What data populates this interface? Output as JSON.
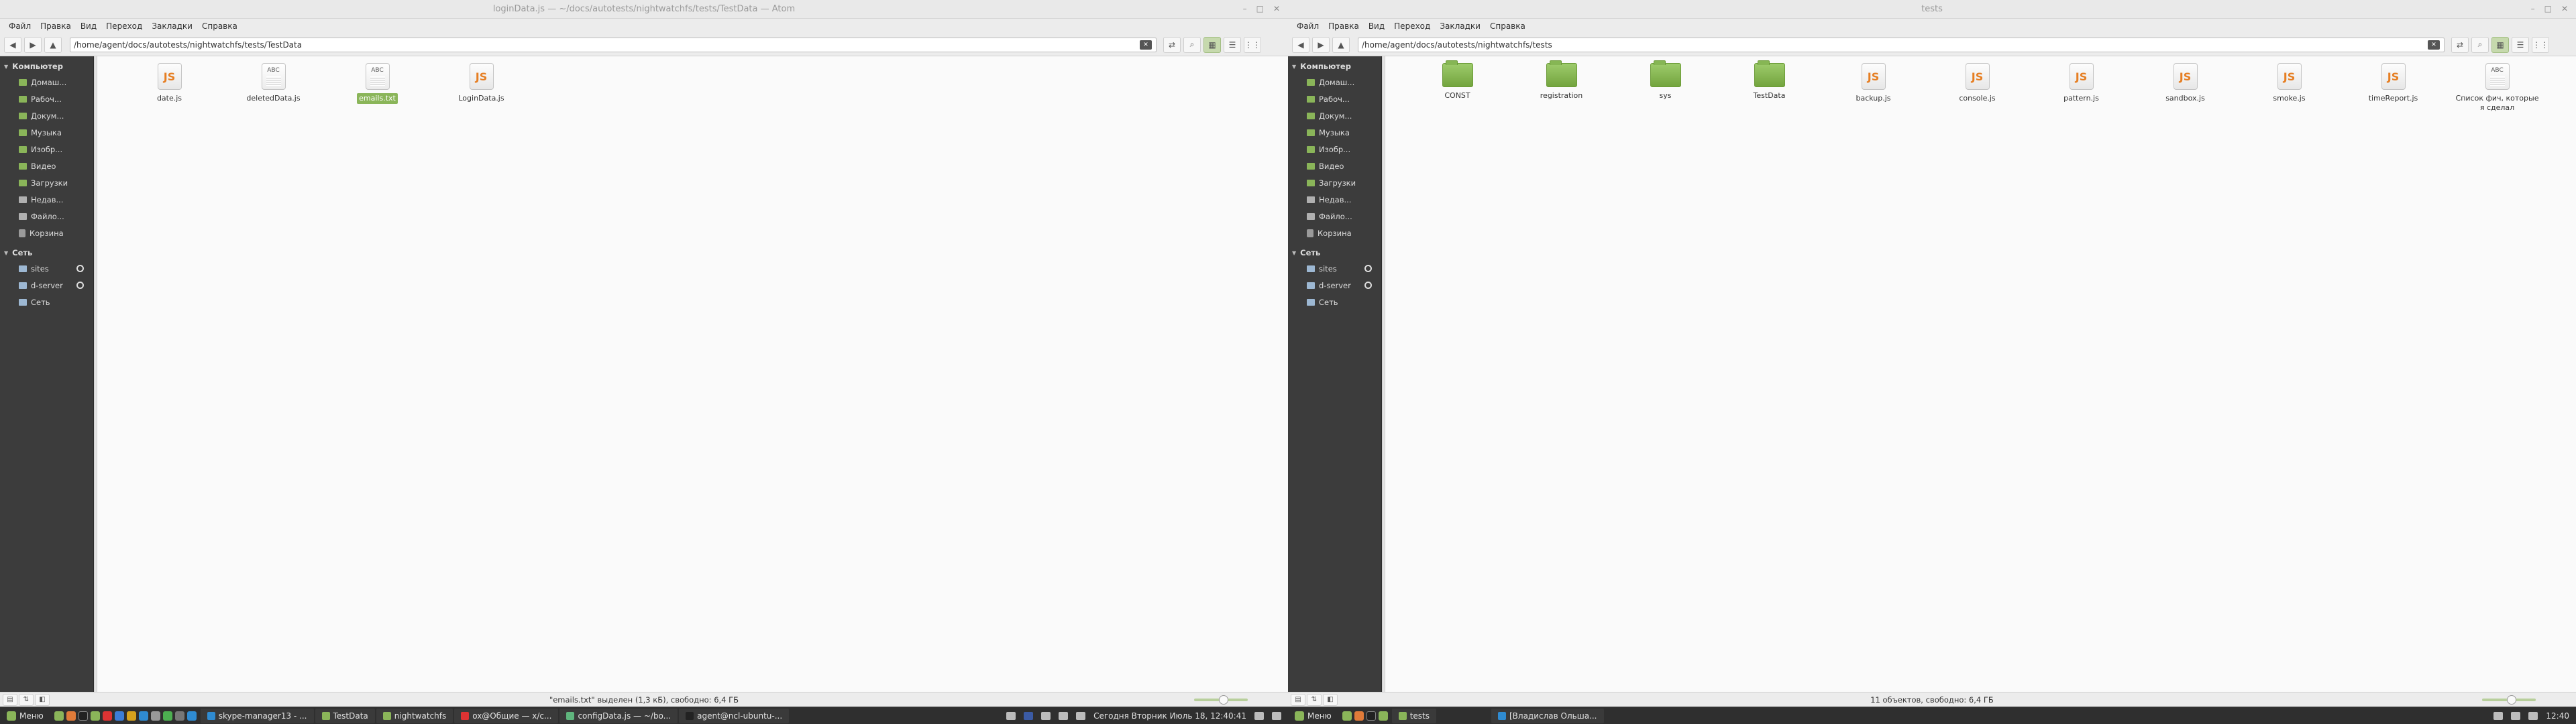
{
  "left_window": {
    "title": "loginData.js — ~/docs/autotests/nightwatchfs/tests/TestData — Atom",
    "menu": [
      "Файл",
      "Правка",
      "Вид",
      "Переход",
      "Закладки",
      "Справка"
    ],
    "path": "/home/agent/docs/autotests/nightwatchfs/tests/TestData",
    "files": [
      {
        "name": "date.js",
        "icon": "js"
      },
      {
        "name": "deletedData.js",
        "icon": "txt"
      },
      {
        "name": "emails.txt",
        "icon": "txt",
        "selected": true
      },
      {
        "name": "LoginData.js",
        "icon": "js"
      }
    ],
    "status": "\"emails.txt\" выделен (1,3 кБ), свободно: 6,4 ГБ"
  },
  "right_window": {
    "title": "tests",
    "menu": [
      "Файл",
      "Правка",
      "Вид",
      "Переход",
      "Закладки",
      "Справка"
    ],
    "path": "/home/agent/docs/autotests/nightwatchfs/tests",
    "files": [
      {
        "name": "CONST",
        "icon": "folder"
      },
      {
        "name": "registration",
        "icon": "folder"
      },
      {
        "name": "sys",
        "icon": "folder"
      },
      {
        "name": "TestData",
        "icon": "folder"
      },
      {
        "name": "backup.js",
        "icon": "js"
      },
      {
        "name": "console.js",
        "icon": "js"
      },
      {
        "name": "pattern.js",
        "icon": "js"
      },
      {
        "name": "sandbox.js",
        "icon": "js"
      },
      {
        "name": "smoke.js",
        "icon": "js"
      },
      {
        "name": "timeReport.js",
        "icon": "js"
      },
      {
        "name": "Список фич, которые я сделал",
        "icon": "txt"
      }
    ],
    "status": "11 объектов, свободно: 6,4 ГБ"
  },
  "sidebar": {
    "computer_label": "Компьютер",
    "computer_items": [
      "Домаш...",
      "Рабоч...",
      "Докум...",
      "Музыка",
      "Изобр...",
      "Видео",
      "Загрузки",
      "Недав...",
      "Файло...",
      "Корзина"
    ],
    "network_label": "Сеть",
    "network_items": [
      "sites",
      "d-server",
      "Сеть"
    ]
  },
  "taskbar_left": {
    "menu_label": "Меню",
    "tasks": [
      "skype-manager13 - ...",
      "TestData",
      "nightwatchfs",
      "ox@Общие — x/c...",
      "configData.js — ~/bo...",
      "agent@ncl-ubuntu-..."
    ],
    "clock": "Сегодня Вторник Июль 18, 12:40:41"
  },
  "taskbar_right": {
    "menu_label": "Меню",
    "tasks": [
      "tests",
      "[Владислав Ольша..."
    ],
    "clock": "12:40"
  },
  "icons_text": {
    "js": "JS",
    "txt": "ABC"
  },
  "zoom_level": 0.55
}
